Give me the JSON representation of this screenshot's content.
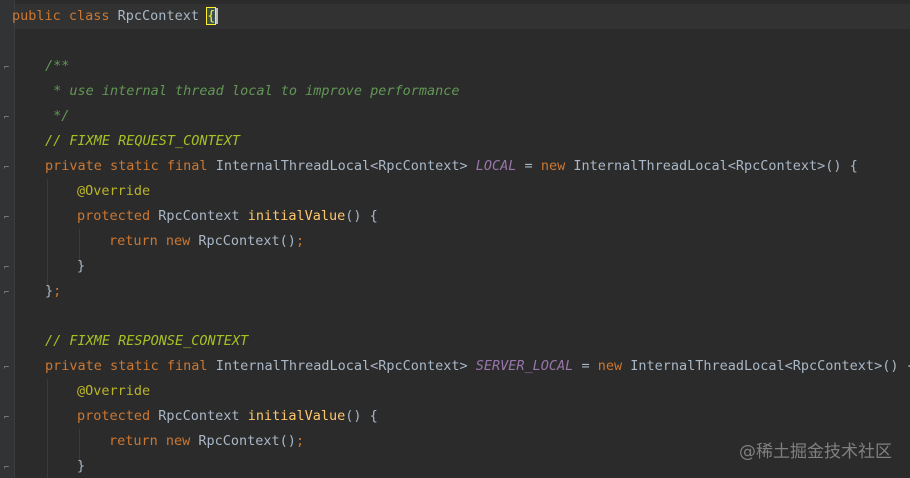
{
  "code": {
    "line1": {
      "kw": "public class ",
      "cls": "RpcContext ",
      "brace": "{"
    },
    "line3": {
      "doc": "/**"
    },
    "line4": {
      "doc": " * use internal thread local to improve performance"
    },
    "line5": {
      "doc": " */"
    },
    "line6": {
      "todo": "// FIXME REQUEST_CONTEXT"
    },
    "line7": {
      "kw": "private static final ",
      "type": "InternalThreadLocal<RpcContext> ",
      "field": "LOCAL",
      "eq": " = ",
      "new": "new ",
      "ctor": "InternalThreadLocal<RpcContext>() {"
    },
    "line8": {
      "ann": "@Override"
    },
    "line9": {
      "kw": "protected ",
      "type": "RpcContext ",
      "fn": "initialValue",
      "rest": "() {"
    },
    "line10": {
      "kw": "return new ",
      "type": "RpcContext()",
      "semi": ";"
    },
    "line11": {
      "brace": "}"
    },
    "line12": {
      "brace": "}",
      "semi": ";"
    },
    "line14": {
      "todo": "// FIXME RESPONSE_CONTEXT"
    },
    "line15": {
      "kw": "private static final ",
      "type": "InternalThreadLocal<RpcContext> ",
      "field": "SERVER_LOCAL",
      "eq": " = ",
      "new": "new ",
      "ctor": "InternalThreadLocal<RpcContext>() {"
    },
    "line16": {
      "ann": "@Override"
    },
    "line17": {
      "kw": "protected ",
      "type": "RpcContext ",
      "fn": "initialValue",
      "rest": "() {"
    },
    "line18": {
      "kw": "return new ",
      "type": "RpcContext()",
      "semi": ";"
    },
    "line19": {
      "brace": "}"
    }
  },
  "watermark": "@稀土掘金技术社区",
  "colors": {
    "background": "#2b2b2b",
    "keyword": "#cc7832",
    "doc_comment": "#629755",
    "todo_comment": "#a8c023",
    "annotation": "#bbb529",
    "method": "#ffc66d",
    "static_field": "#9876aa",
    "text": "#a9b7c6"
  }
}
